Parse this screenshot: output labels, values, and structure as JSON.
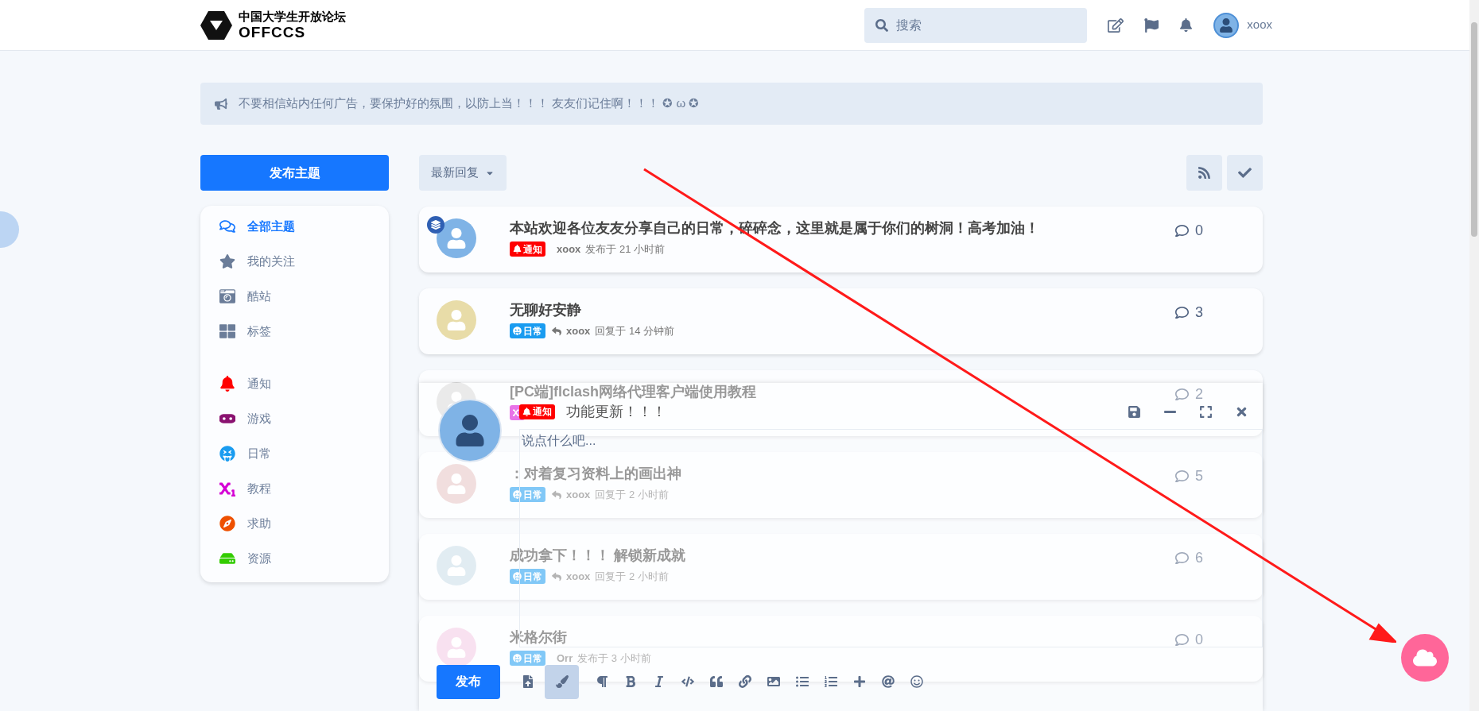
{
  "header": {
    "site_name": "中国大学生开放论坛",
    "site_code": "OFFCCS",
    "search": {
      "placeholder": "搜索"
    },
    "username": "xoox"
  },
  "notice": {
    "text": "不要相信站内任何广告，要保护好的氛围，以防上当！！！ 友友们记住啊！！！ ✪ ω ✪"
  },
  "sidebar": {
    "new_topic_button": "发布主题",
    "nav_items": [
      {
        "kind": "discussions",
        "label": "全部主题",
        "selected": true
      },
      {
        "kind": "star",
        "label": "我的关注",
        "selected": false
      },
      {
        "kind": "camera",
        "label": "酷站",
        "selected": false
      },
      {
        "kind": "tags",
        "label": "标签",
        "selected": false
      }
    ],
    "tag_items": [
      {
        "kind": "bell",
        "label": "通知",
        "color": "#ff0000"
      },
      {
        "kind": "gamepad",
        "label": "游戏",
        "color": "#8a1270"
      },
      {
        "kind": "grin",
        "label": "日常",
        "color": "#1a9cf0"
      },
      {
        "kind": "subscript",
        "label": "教程",
        "color": "#d500d5"
      },
      {
        "kind": "compass",
        "label": "求助",
        "color": "#ee5000"
      },
      {
        "kind": "drive",
        "label": "资源",
        "color": "#33cc00"
      }
    ]
  },
  "list_toolbar": {
    "sort_button": "最新回复"
  },
  "posts": [
    {
      "title": "本站欢迎各位友友分享自己的日常，碎碎念，这里就是属于你们的树洞！高考加油！",
      "sticky": true,
      "tag": {
        "kind": "bell",
        "label": "通知",
        "color": "#ff0000"
      },
      "author": "xoox",
      "kind": "post",
      "time": "发布于 21 小时前",
      "comments": "0"
    },
    {
      "title": "无聊好安静",
      "sticky": false,
      "tag": {
        "kind": "grin",
        "label": "日常",
        "color": "#1a9cf0"
      },
      "author": "xoox",
      "kind": "reply",
      "time": "回复于 14 分钟前",
      "comments": "3"
    },
    {
      "title": "[PC端]flclash网络代理客户端使用教程",
      "sticky": false,
      "tag": {
        "kind": "subscript"
      },
      "comments": "2"
    },
    {
      "title": "：对着复习资料上的画出神",
      "sticky": false,
      "tag": {
        "kind": "grin",
        "label": "日常"
      },
      "author": "xoox",
      "kind": "reply",
      "time": "回复于 2 小时前",
      "comments": "5"
    },
    {
      "title": "成功拿下！！！ 解锁新成就",
      "sticky": false,
      "tag": {
        "kind": "grin",
        "label": "日常"
      },
      "author": "xoox",
      "kind": "reply",
      "time": "回复于 2 小时前",
      "comments": "6"
    },
    {
      "title": "米格尔街",
      "sticky": false,
      "tag": {
        "kind": "grin",
        "label": "日常"
      },
      "author": "Orr",
      "kind": "post",
      "time": "发布于 3 小时前",
      "comments": "0"
    }
  ],
  "composer": {
    "tag": {
      "label": "通知",
      "color": "#ff0000"
    },
    "title": "功能更新！！！",
    "placeholder": "说点什么吧...",
    "submit_button": "发布",
    "tools": [
      {
        "kind": "upload",
        "selected": false
      },
      {
        "kind": "brush",
        "selected": true
      },
      {
        "kind": "paragraph",
        "selected": false
      },
      {
        "kind": "bold",
        "selected": false
      },
      {
        "kind": "italic",
        "selected": false
      },
      {
        "kind": "code",
        "selected": false
      },
      {
        "kind": "quote",
        "selected": false
      },
      {
        "kind": "link",
        "selected": false
      },
      {
        "kind": "image",
        "selected": false
      },
      {
        "kind": "bullets",
        "selected": false
      },
      {
        "kind": "numbers",
        "selected": false
      },
      {
        "kind": "plus",
        "selected": false
      },
      {
        "kind": "mention",
        "selected": false
      },
      {
        "kind": "emoji",
        "selected": false
      }
    ]
  }
}
